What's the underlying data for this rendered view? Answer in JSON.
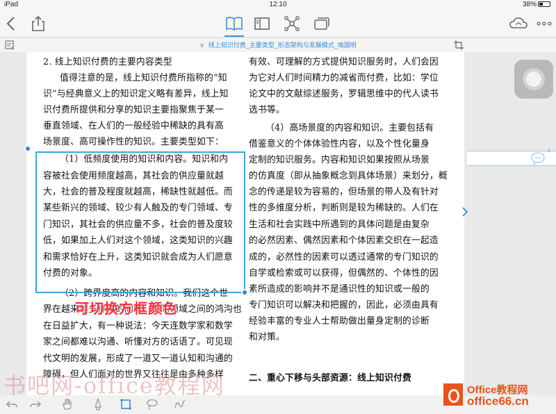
{
  "status": {
    "left": "iPad",
    "time": "12:10",
    "battery": "38%"
  },
  "document": {
    "title": "线上知识付费_主要类型_形态架构与发展模式_喻国明"
  },
  "left_column": [
    "2. 线上知识付费的主要内容类型",
    "值得注意的是，线上知识付费所指称的“知",
    "识”与经典意义上的知识定义略有差异，线上知",
    "识付费所提供和分享的知识主要指聚焦于某一",
    "垂直领域、在人们的一般经验中稀缺的具有高",
    "场景度、高可操作性的知识。主要类型如下：",
    "（1）低频度使用的知识和内容。知识和内",
    "容被社会使用频度越高，其社会的供应量就越",
    "大，社会的普及程度就越高，稀缺性就越低。而",
    "某些新兴的领域、较少有人触及的专门领域、专",
    "门知识，其社会的供应量不多，社会的普及度较",
    "低，如果加上人们对这个领域，这类知识的兴趣",
    "和需求恰好在上升，这类知识就会成为人们愿意",
    "付费的对象。",
    "（2）跨界度高的内容和知识。我们这个世",
    "界在越来越多样化的同时，不同领域之间的鸿沟也",
    "在日益扩大，有一种说法：今天连数学家和数学",
    "家之间都难以沟通、听懂对方的话语了。可见现",
    "代文明的发展，形成了一道又一道认知和沟通的",
    "障碍，但人们面对的世界又往往是由多种多样"
  ],
  "right_column": [
    "有效、可理解的方式提供知识服务时，人们会因",
    "为它对人们时间精力的减省而付费，比如：学位",
    "论文中的文献综述服务，罗辑思维中的代人读书",
    "选书等。",
    "（4）高场景度的内容和知识。主要包括有",
    "借鉴意义的个体体验性内容，以及个性化量身",
    "定制的知识服务。内容和知识如果按照从场景",
    "的仿真度（即从抽象概念到具体场景）来划分，概",
    "念的传递是较为容易的，但场景的带人及有针对",
    "性的多维度分析，判断则是较为稀缺的。人们在",
    "生活和社会实践中所遇到的具体问题是由复杂",
    "的必然因素、偶然因素和个体因素交织在一起造",
    "成的，必然性的因素可以透过通常的专门知识的",
    "自学或检索或可以获得，但偶然的、个体性的因",
    "素所造成的影响并不是通识性的知识或一般的",
    "专门知识可以解决和把握的，因此，必须由具有",
    "经验丰富的专业人士帮助做出量身定制的诊断",
    "和对策。",
    "二、重心下移与头部资源：线上知识付费"
  ],
  "overlay_caption": "可切换方框颜色",
  "comment_count": "1",
  "watermark": "书吧网-office教程网",
  "logo": {
    "line1": "Office教程网",
    "line2": "office66.cn"
  }
}
